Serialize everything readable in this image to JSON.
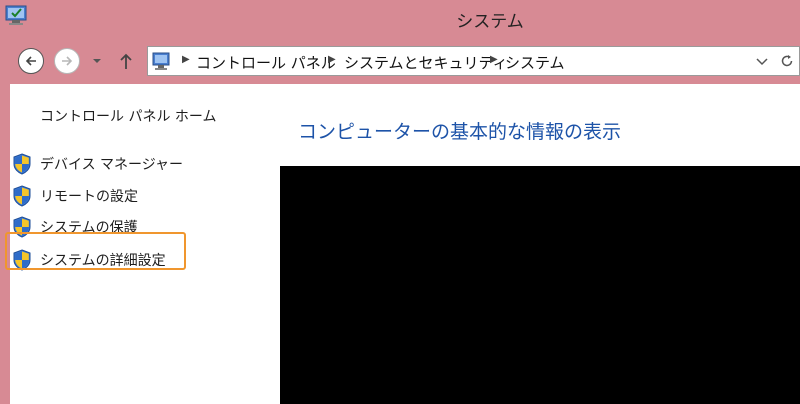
{
  "window": {
    "title": "システム"
  },
  "nav": {
    "back_icon": "back-arrow-icon",
    "forward_icon": "forward-arrow-icon",
    "recent_icon": "dropdown-caret-icon",
    "up_icon": "up-arrow-icon",
    "breadcrumb": [
      "コントロール パネル",
      "システムとセキュリティ",
      "システム"
    ],
    "refresh_icon": "refresh-icon"
  },
  "sidebar": {
    "home_label": "コントロール パネル ホーム",
    "items": [
      {
        "label": "デバイス マネージャー",
        "icon": "uac-shield-icon"
      },
      {
        "label": "リモートの設定",
        "icon": "uac-shield-icon"
      },
      {
        "label": "システムの保護",
        "icon": "uac-shield-icon"
      },
      {
        "label": "システムの詳細設定",
        "icon": "uac-shield-icon"
      }
    ]
  },
  "main": {
    "heading": "コンピューターの基本的な情報の表示"
  },
  "colors": {
    "titlebar": "#d78a94",
    "heading": "#1d53a8",
    "highlight": "#f0962e",
    "redacted_panel": "#000000"
  }
}
